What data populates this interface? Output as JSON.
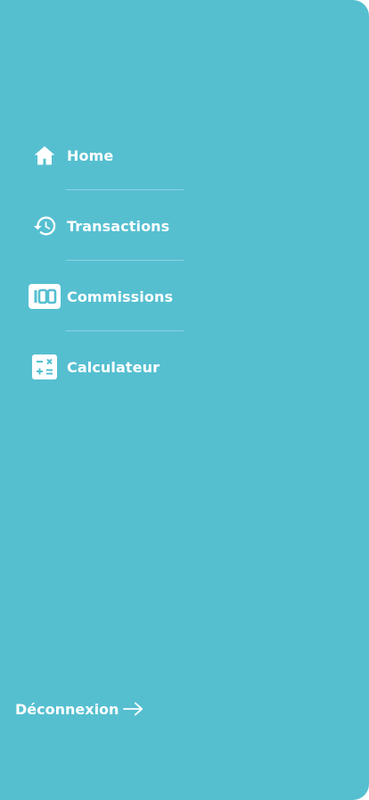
{
  "theme": {
    "background": "#55bfd0",
    "text": "#ffffff"
  },
  "menu": {
    "items": [
      {
        "label": "Home",
        "icon": "home-icon"
      },
      {
        "label": "Transactions",
        "icon": "history-icon"
      },
      {
        "label": "Commissions",
        "icon": "counter-icon",
        "counter_text": "100"
      },
      {
        "label": "Calculateur",
        "icon": "calculator-icon"
      }
    ]
  },
  "logout": {
    "label": "Déconnexion",
    "icon": "arrow-right-icon"
  }
}
